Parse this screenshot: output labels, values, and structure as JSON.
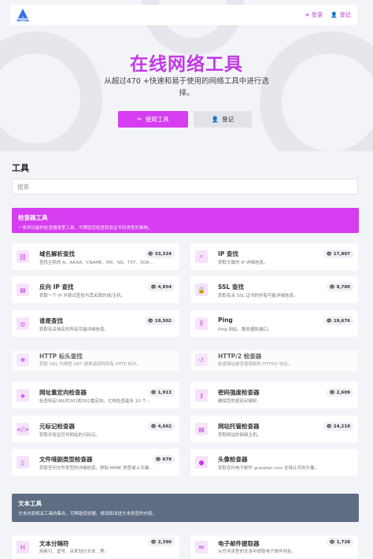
{
  "header": {
    "login_label": "登录",
    "register_label": "登记"
  },
  "hero": {
    "title": "在线网络工具",
    "subtitle": "从超过470 +快速和易于使用的网络工具中进行选择。",
    "primary_button": "使用工具",
    "secondary_button": "登记"
  },
  "tools": {
    "heading": "工具",
    "search_placeholder": "搜索"
  },
  "categories": [
    {
      "title": "检查器工具",
      "description": "一系列功能的检查器类型工具，可帮助您检查和验证不同类型的事物。",
      "color": "#d63df0"
    },
    {
      "title": "文本工具",
      "description": "文本内容相关工具的集合，可帮助您创建、修改和改进文本类型的内容。",
      "color": "#5e6c84"
    }
  ],
  "cards": [
    {
      "title": "域名解析查找",
      "desc": "查找主机的 A、AAAA、CNAME、MX、NS、TXT、SOA...",
      "views": "33,324",
      "icon": "network-icon"
    },
    {
      "title": "IP 查找",
      "desc": "获取大致的 IP 详细信息。",
      "views": "17,807",
      "icon": "search-location-icon"
    },
    {
      "title": "反向 IP 查找",
      "desc": "获取一个 IP 并尝试查找与其关联的域/主机。",
      "views": "4,954",
      "icon": "server-icon"
    },
    {
      "title": "SSL 查找",
      "desc": "获取有关 SSL 证书的所有可能详细信息。",
      "views": "9,700",
      "icon": "lock-icon"
    },
    {
      "title": "谁是查找",
      "desc": "获取有关域名的所有可能详细信息。",
      "views": "19,502",
      "icon": "globe-icon"
    },
    {
      "title": "Ping",
      "desc": "Ping 网站、服务器和端口。",
      "views": "19,676",
      "icon": "signal-icon"
    },
    {
      "title": "HTTP 标头查找",
      "desc": "获取 URL 为典型 GET 请求返回的所有 HTTP 标头。",
      "views": "",
      "icon": "asterisk-icon"
    },
    {
      "title": "HTTP/2 检查器",
      "desc": "检查网站是否使用新的 HTTP/2 协议。",
      "views": "",
      "icon": "history-icon"
    },
    {
      "title": "网址重定向检查器",
      "desc": "检查特定URL的301和302重定向。它将检查最多 10 个重...",
      "views": "1,913",
      "icon": "directions-icon"
    },
    {
      "title": "密码强度检查器",
      "desc": "确保您的密码足够好。",
      "views": "2,609",
      "icon": "key-icon"
    },
    {
      "title": "元标记检查器",
      "desc": "获取并验证任何网站的元标记。",
      "views": "4,662",
      "icon": "code-icon"
    },
    {
      "title": "网站托管检查器",
      "desc": "获取网站的网络主机。",
      "views": "24,210",
      "icon": "server-icon"
    },
    {
      "title": "文件哑剧类型检查器",
      "desc": "获取任何文件类型的详细信息，例如 MIME 类型或上次编...",
      "views": "679",
      "icon": "file-icon"
    },
    {
      "title": "头像检查器",
      "desc": "获取任何电子邮件 gravatar.com 全球认可的头像。",
      "views": "",
      "icon": "user-icon"
    },
    {
      "title": "文本分隔符",
      "desc": "用新行、逗号、点来划分文本…等。",
      "views": "2,390",
      "icon": "text-height-icon"
    },
    {
      "title": "电子邮件提取器",
      "desc": "从任何类型的文本中提取电子邮件地址。",
      "views": "1,728",
      "icon": "envelope-icon"
    }
  ]
}
